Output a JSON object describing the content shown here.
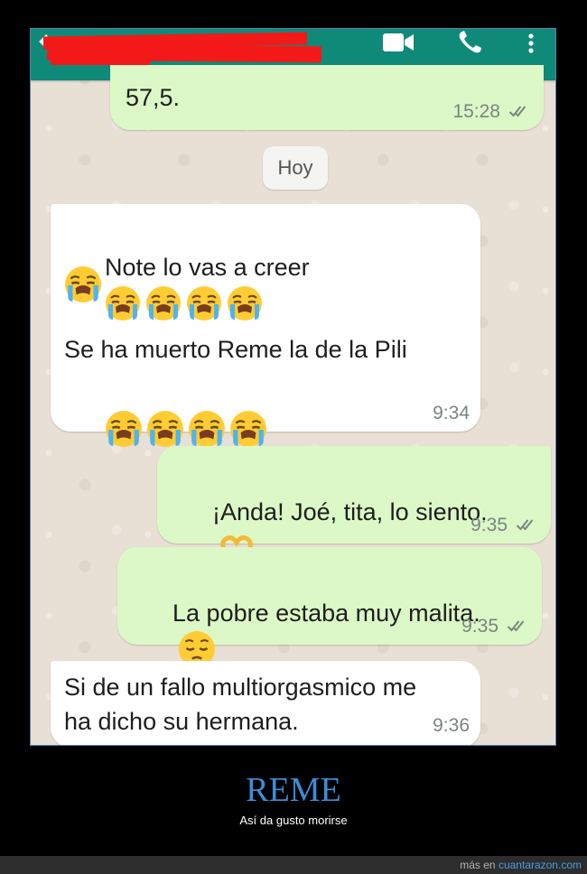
{
  "chat": {
    "contact_name_redacted": true,
    "partial_message": {
      "text": "57,5.",
      "time": "15:28",
      "status": "read"
    },
    "date_chip": "Hoy",
    "messages": [
      {
        "direction": "incoming",
        "line1": "Note lo vas a creer",
        "line2": "",
        "line3": "Se ha muerto Reme la de la Pili",
        "time": "9:34",
        "emojis": [
          "crying-face",
          "crying-face",
          "crying-face",
          "crying-face",
          "crying-face",
          "crying-face",
          "crying-face",
          "crying-face",
          "crying-face"
        ]
      },
      {
        "direction": "outgoing",
        "text": "¡Anda! Joé, tita, lo siento.",
        "time": "9:35",
        "status": "read",
        "emojis": [
          "heart-hands"
        ]
      },
      {
        "direction": "outgoing",
        "text": "La pobre estaba muy malita.",
        "time": "9:35",
        "status": "read",
        "emojis": [
          "pensive-face"
        ]
      },
      {
        "direction": "incoming",
        "line1": "Si de un fallo multiorgasmico me",
        "line2": "ha dicho su hermana.",
        "time": "9:36"
      }
    ]
  },
  "caption": {
    "title": "REME",
    "subtitle": "Así da gusto morirse"
  },
  "footer": {
    "prefix": "más en",
    "site": "cuantarazon.com"
  },
  "colors": {
    "header": "#0f8a78",
    "outgoing_bubble": "#dcf8c6",
    "incoming_bubble": "#ffffff",
    "caption_title": "#3b8ed8",
    "redaction": "#f41919"
  }
}
